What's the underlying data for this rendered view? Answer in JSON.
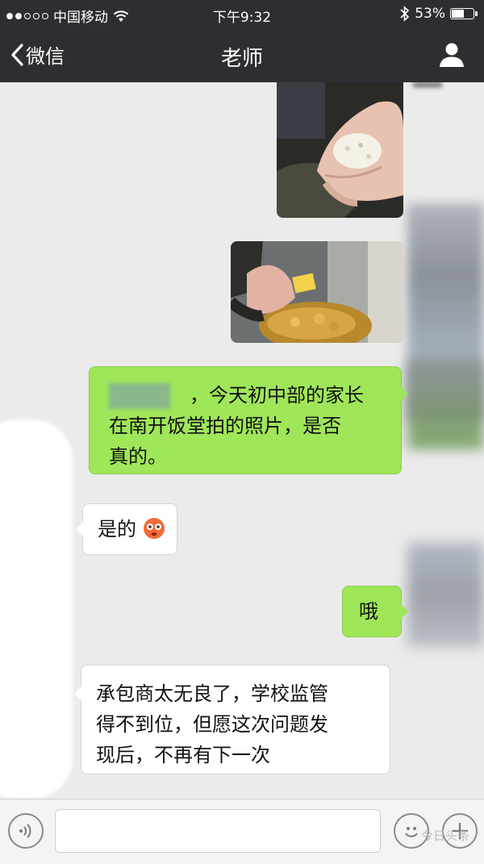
{
  "status_bar": {
    "carrier": "中国移动",
    "time": "下午9:32",
    "battery_percent": "53%",
    "battery_level": 0.53,
    "icons": [
      "signal-dots-icon",
      "wifi-icon",
      "bluetooth-icon",
      "battery-icon"
    ]
  },
  "nav": {
    "back_label": "微信",
    "title": "老师",
    "icons": [
      "chevron-left-icon",
      "person-icon"
    ]
  },
  "messages": [
    {
      "from": "me",
      "type": "image",
      "description": "hand holding rice"
    },
    {
      "from": "me",
      "type": "image",
      "description": "hand holding food over a bowl"
    },
    {
      "from": "me",
      "type": "text",
      "text": "，今天初中部的家长在南开饭堂拍的照片，是否真的。",
      "lines": [
        "，今天初中部的家长",
        "在南开饭堂拍的照片，是否",
        "真的。"
      ]
    },
    {
      "from": "them",
      "type": "text",
      "text": "是的",
      "emoji": "flushed-face-icon"
    },
    {
      "from": "me",
      "type": "text",
      "text": "哦"
    },
    {
      "from": "them",
      "type": "text",
      "lines": [
        "承包商太无良了，学校监管",
        "得不到位，但愿这次问题发",
        "现后，不再有下一次"
      ]
    }
  ],
  "input_bar": {
    "text_value": "",
    "icons": [
      "voice-icon",
      "emoji-icon",
      "plus-icon"
    ]
  },
  "watermark": "今日头条",
  "colors": {
    "nav_bg": "#2e2e32",
    "chat_bg": "#ebebeb",
    "my_bubble": "#9fe659",
    "their_bubble": "#ffffff"
  }
}
